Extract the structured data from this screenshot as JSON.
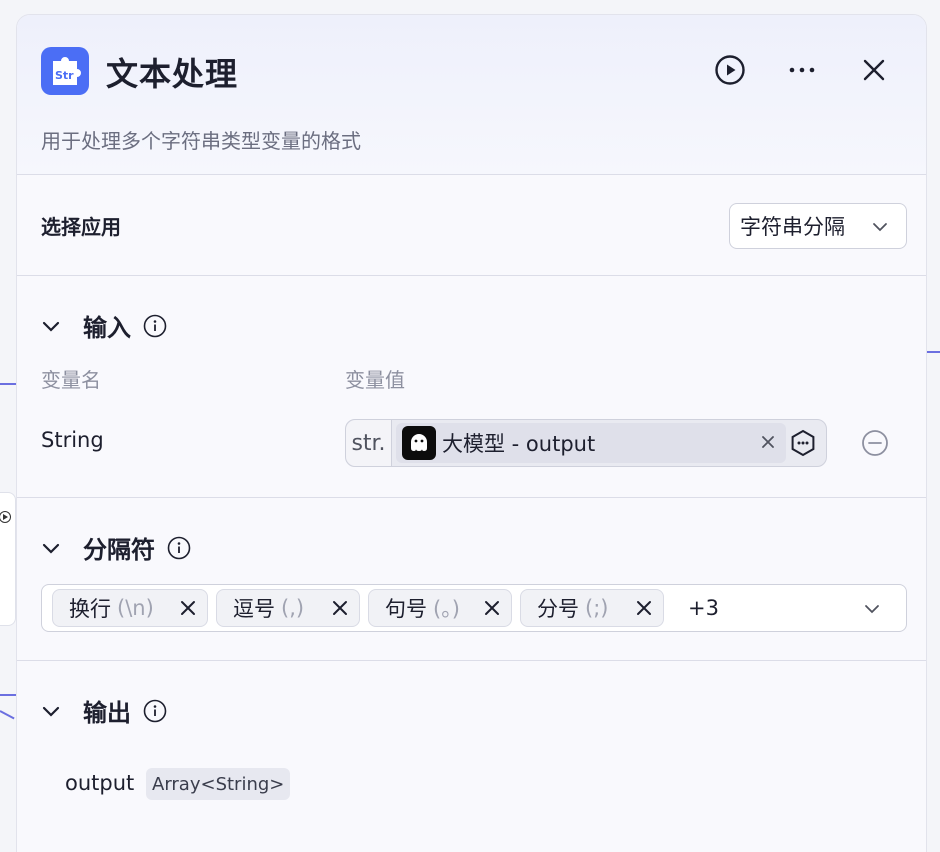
{
  "node": {
    "title": "文本处理",
    "description": "用于处理多个字符串类型变量的格式",
    "icon": "string-puzzle-icon",
    "accent_color": "#4b6ef5"
  },
  "app_select": {
    "label": "选择应用",
    "value": "字符串分隔"
  },
  "input": {
    "title": "输入",
    "col_name": "变量名",
    "col_value": "变量值",
    "rows": [
      {
        "name": "String",
        "type_badge": "str.",
        "ref": "大模型 - output"
      }
    ]
  },
  "separator": {
    "title": "分隔符",
    "tags": [
      {
        "label": "换行",
        "symbol": "(\\n)"
      },
      {
        "label": "逗号",
        "symbol": "(,)"
      },
      {
        "label": "句号",
        "symbol": "(。)"
      },
      {
        "label": "分号",
        "symbol": "(;)"
      }
    ],
    "more": "+3"
  },
  "output": {
    "title": "输出",
    "name": "output",
    "type": "Array<String>"
  }
}
